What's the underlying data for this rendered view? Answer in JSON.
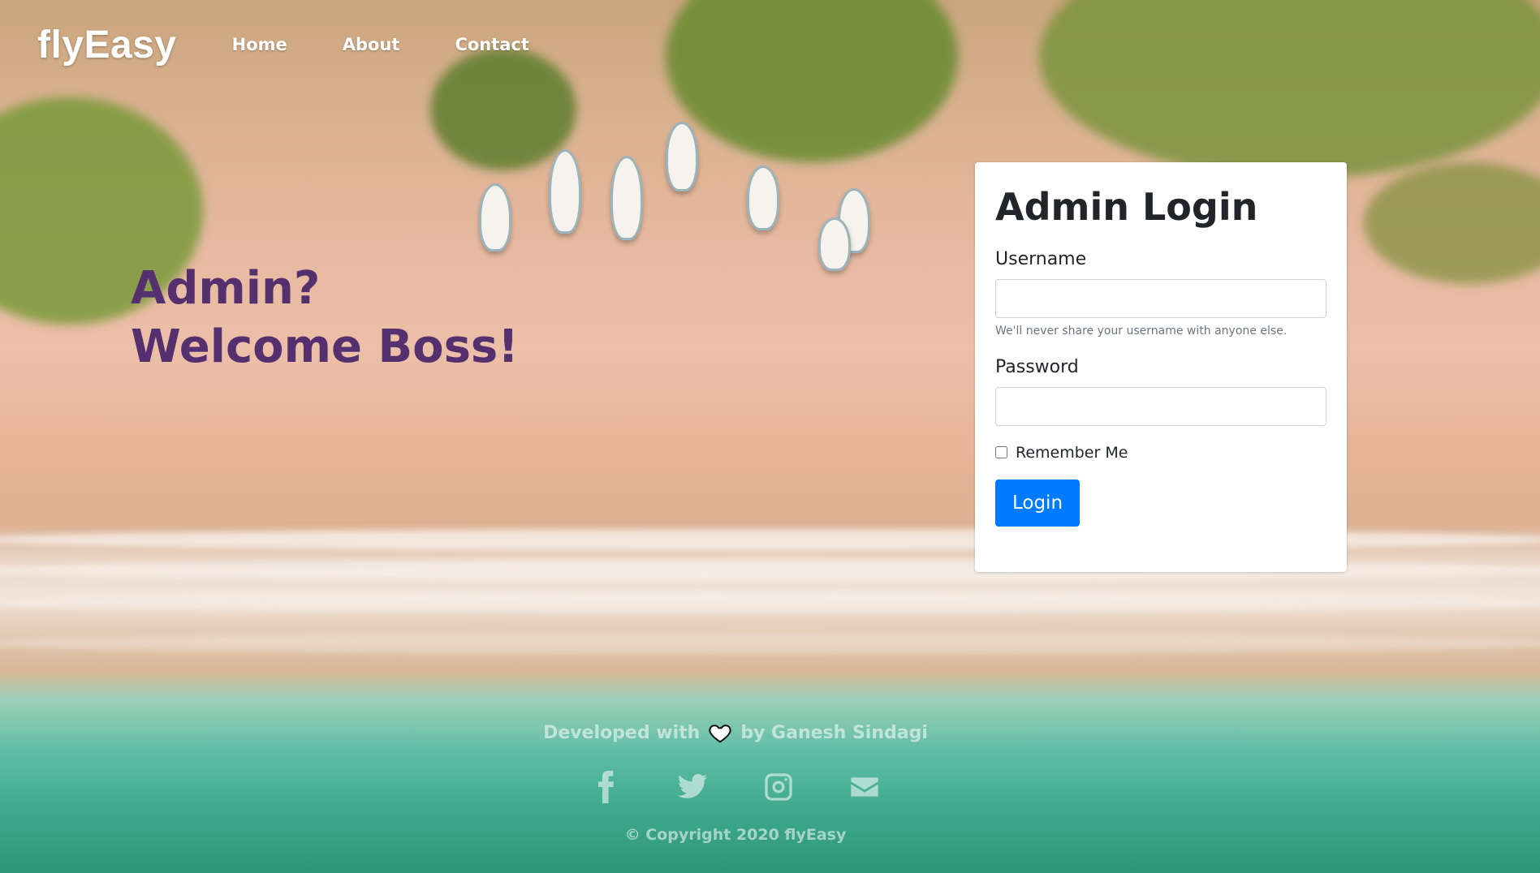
{
  "nav": {
    "brand": "flyEasy",
    "links": [
      "Home",
      "About",
      "Contact"
    ]
  },
  "hero": {
    "line1": "Admin?",
    "line2": "Welcome Boss!"
  },
  "login": {
    "title": "Admin Login",
    "username_label": "Username",
    "username_value": "",
    "username_help": "We'll never share your username with anyone else.",
    "password_label": "Password",
    "password_value": "",
    "remember_label": "Remember Me",
    "remember_checked": false,
    "button_label": "Login"
  },
  "footer": {
    "developed_prefix": "Developed with",
    "developed_suffix": "by Ganesh Sindagi",
    "social_icons": [
      "facebook-icon",
      "twitter-icon",
      "instagram-icon",
      "envelope-icon"
    ],
    "copyright": "© Copyright 2020 flyEasy"
  },
  "colors": {
    "hero_text": "#54306f",
    "primary_button": "#007bff",
    "card_bg": "#ffffff"
  }
}
